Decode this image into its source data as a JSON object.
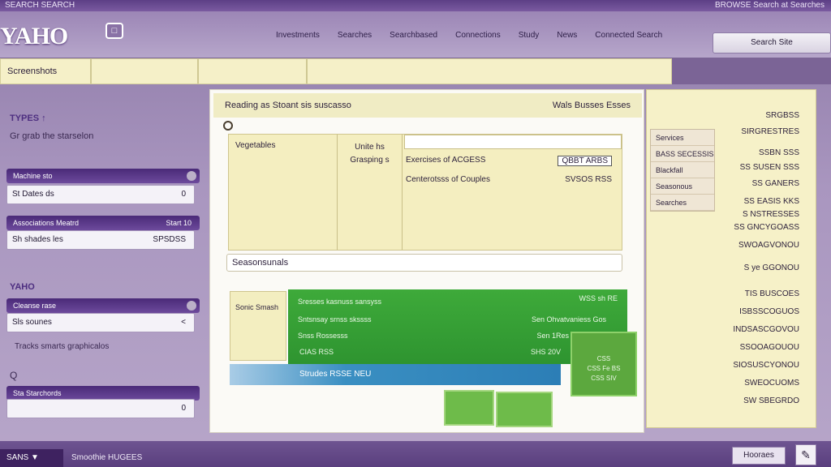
{
  "top_strip": {
    "left": "SEARCH SEARCH",
    "right": "BROWSE Search at Searches"
  },
  "header": {
    "logo": "YAHO",
    "logo_box": "□",
    "nav": [
      "Investments",
      "Searches",
      "Searchbased",
      "Connections",
      "Study",
      "News",
      "Connected Search"
    ],
    "search_button": "Search Site"
  },
  "tabbar": {
    "tab1": "Screenshots",
    "tab2": "",
    "tab3": "",
    "tab4": ""
  },
  "sidebar": {
    "head1": "TYPES ↑",
    "sub1": "Gr grab the starselon",
    "bar1": "Machine sto",
    "field1": {
      "label": "St Dates ds",
      "value": "0"
    },
    "bar2": {
      "label": "Associations Meatrd",
      "value": "Start 10"
    },
    "field2": {
      "label": "Sh shades les",
      "value": "SPSDSS"
    },
    "head2": "YAHO",
    "bar3": "Cleanse rase",
    "field3": {
      "label": "Sls sounes",
      "value": "<"
    },
    "link": "Tracks smarts graphicalos",
    "q_icon": "Q",
    "bar4": "Sta Starchords",
    "field4": {
      "label": "",
      "value": "0"
    }
  },
  "main": {
    "head_left": "Reading as Stoant sis suscasso",
    "head_right": "Wals Busses Esses",
    "col1_label": "Vegetables",
    "col2_line1": "Unite hs",
    "col2_line2": "Grasping s",
    "row1": {
      "label": "Exercises of ACGESS",
      "value": "QBBT ARBS"
    },
    "row2": {
      "label": "Centerotsss of Couples",
      "value": "SVSOS RSS"
    },
    "note": "Seasonsunals",
    "left_card": [
      "Sonic Smash"
    ],
    "green": {
      "r1_left": "Sresses kasnuss sansyss",
      "r1_right": "WSS sh RE",
      "r2_left": "Sntsnsay srnss skssss",
      "r2_right": "Sen Ohvatvaniess Gos",
      "r3_left": "Snss Rossesss",
      "r3_right": "Sen 1Res",
      "r4_left": "CIAS RSS",
      "r4_right": "SHS 20V"
    },
    "blue_bar": "Strudes RSSE NEU",
    "green_card": [
      "CSS",
      "CSS Fe BS",
      "CSS SIV"
    ]
  },
  "right_panel": {
    "table": [
      "Services",
      "BASS SECESSIS",
      "Blackfall",
      "Seasonous",
      "Searches"
    ],
    "list": [
      "SRGBSS",
      "SIRGRESTRES",
      "SSBN SSS",
      "SS SUSEN SSS",
      "SS GANERS",
      "SS EASIS KKS",
      "S NSTRESSES",
      "SS GNCYGOASS",
      "SWOAGVONOU",
      "S ye GGONOU",
      "TIS BUSCOES",
      "ISBSSCOGUOS",
      "INDSASCGOVOU",
      "SSOOAGOUOU",
      "SIOSUSCYONOU",
      "SWEOCUOMS",
      "SW SBEGRDO"
    ]
  },
  "bottom": {
    "tab": "SANS ▼",
    "text": "Smoothie HUGEES",
    "button": "Hooraes",
    "icon": "✎"
  }
}
